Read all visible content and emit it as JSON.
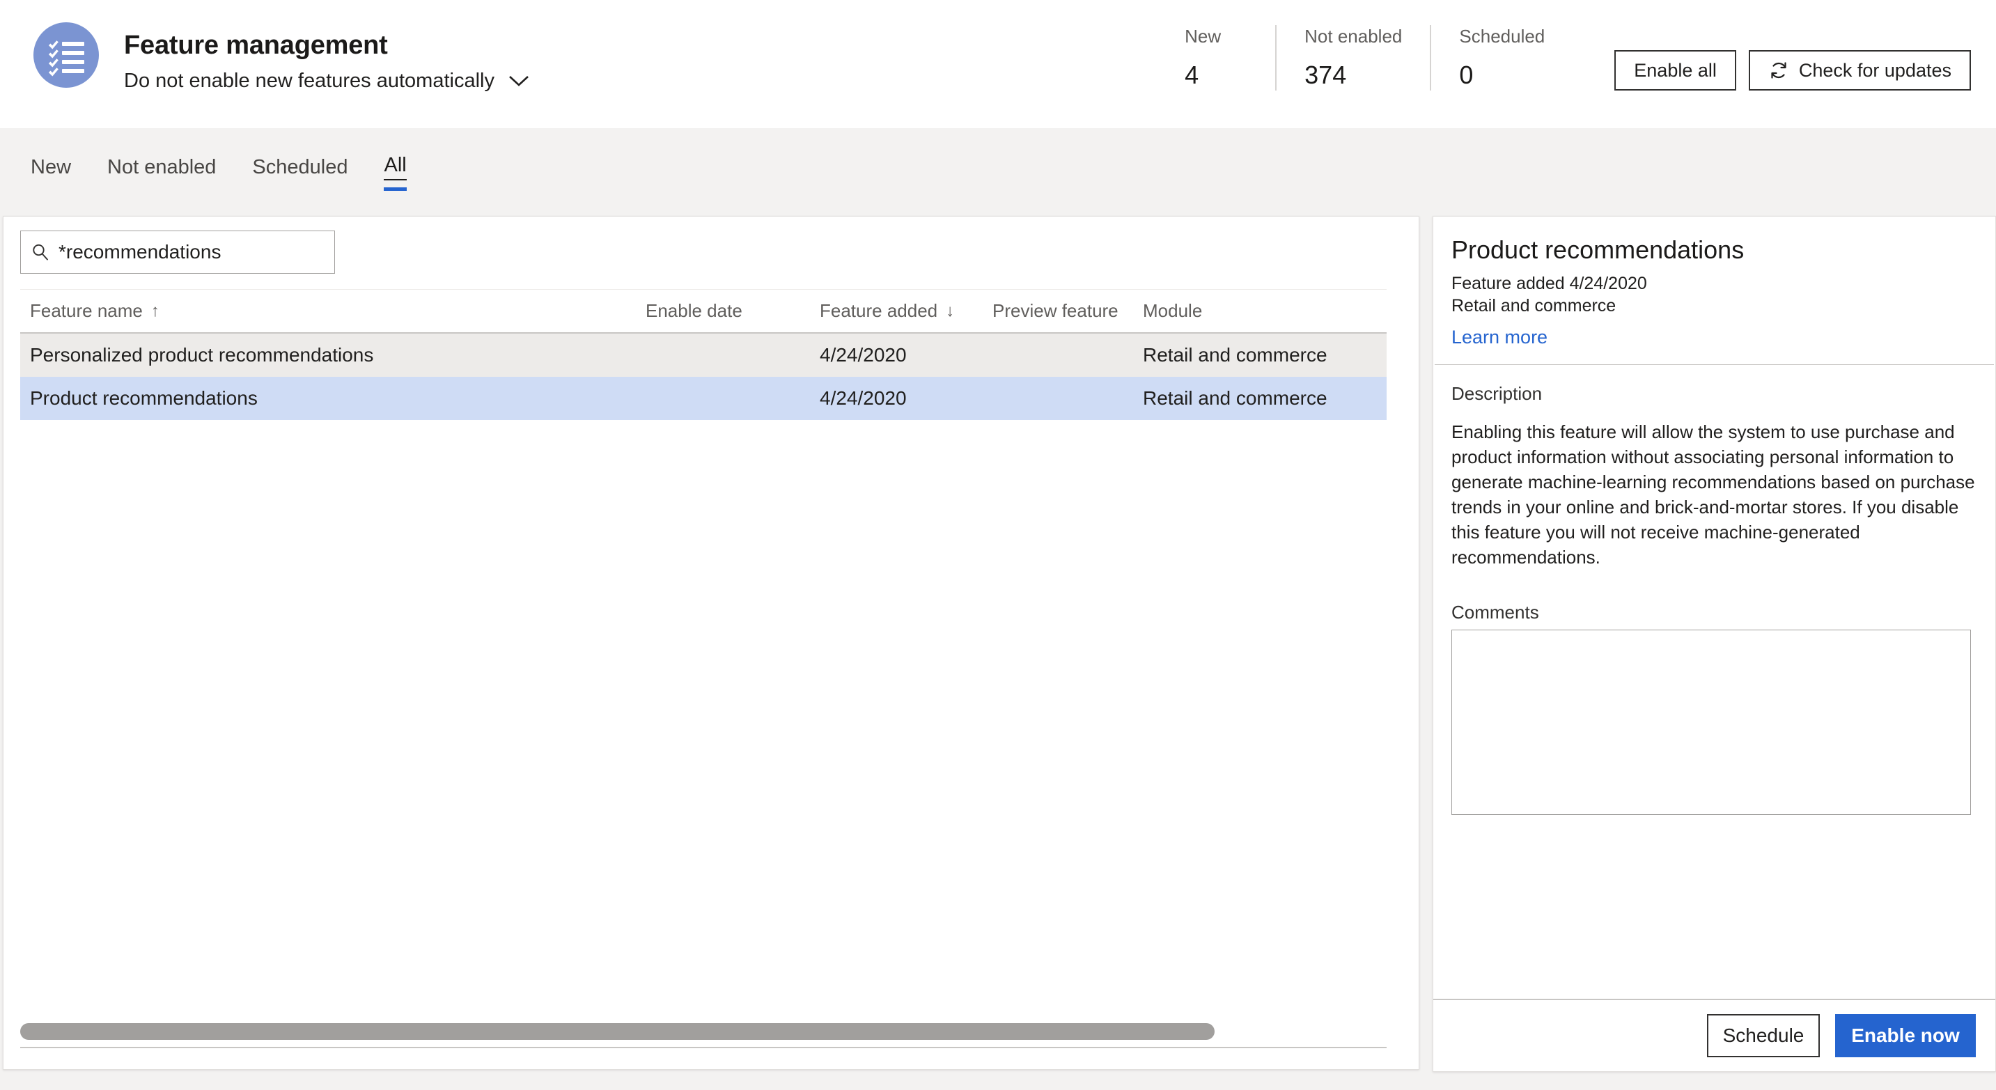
{
  "header": {
    "icon_name": "checklist-icon",
    "title": "Feature management",
    "subtitle": "Do not enable new features automatically",
    "stats": [
      {
        "label": "New",
        "value": "4"
      },
      {
        "label": "Not enabled",
        "value": "374"
      },
      {
        "label": "Scheduled",
        "value": "0"
      }
    ],
    "actions": [
      {
        "label": "Enable all",
        "icon": ""
      },
      {
        "label": "Check for updates",
        "icon": "refresh-icon"
      }
    ]
  },
  "tabs": [
    {
      "label": "New",
      "active": false
    },
    {
      "label": "Not enabled",
      "active": false
    },
    {
      "label": "Scheduled",
      "active": false
    },
    {
      "label": "All",
      "active": true
    }
  ],
  "list": {
    "search": {
      "value": "*recommendations",
      "placeholder": "Filter",
      "icon": "search-icon"
    },
    "columns": [
      {
        "label": "Feature name",
        "sort": "↑"
      },
      {
        "label": "Enable date",
        "sort": ""
      },
      {
        "label": "Feature added",
        "sort": "↓"
      },
      {
        "label": "Preview feature",
        "sort": ""
      },
      {
        "label": "Module",
        "sort": ""
      }
    ],
    "rows": [
      {
        "name": "Personalized product recommendations",
        "enable_date": "",
        "feature_added": "4/24/2020",
        "preview_feature": "",
        "module": "Retail and commerce"
      },
      {
        "name": "Product recommendations",
        "enable_date": "",
        "feature_added": "4/24/2020",
        "preview_feature": "",
        "module": "Retail and commerce"
      }
    ]
  },
  "detail": {
    "title": "Product recommendations",
    "added": "Feature added 4/24/2020",
    "module": "Retail and commerce",
    "learn_more": "Learn more",
    "description_label": "Description",
    "description": "Enabling this feature will allow the system to use purchase and product information without associating personal information to generate machine-learning recommendations based on purchase trends in your online and brick-and-mortar stores. If you disable this feature you will not receive machine-generated recommendations.",
    "comments_label": "Comments",
    "comments_value": "",
    "schedule_label": "Schedule",
    "enable_now_label": "Enable now"
  },
  "colors": {
    "accent": "#2564cf",
    "selected_row": "#cfdcf5",
    "alt_row": "#edebe9",
    "page_bg": "#f3f2f1",
    "icon_bg": "#7b94d2"
  }
}
